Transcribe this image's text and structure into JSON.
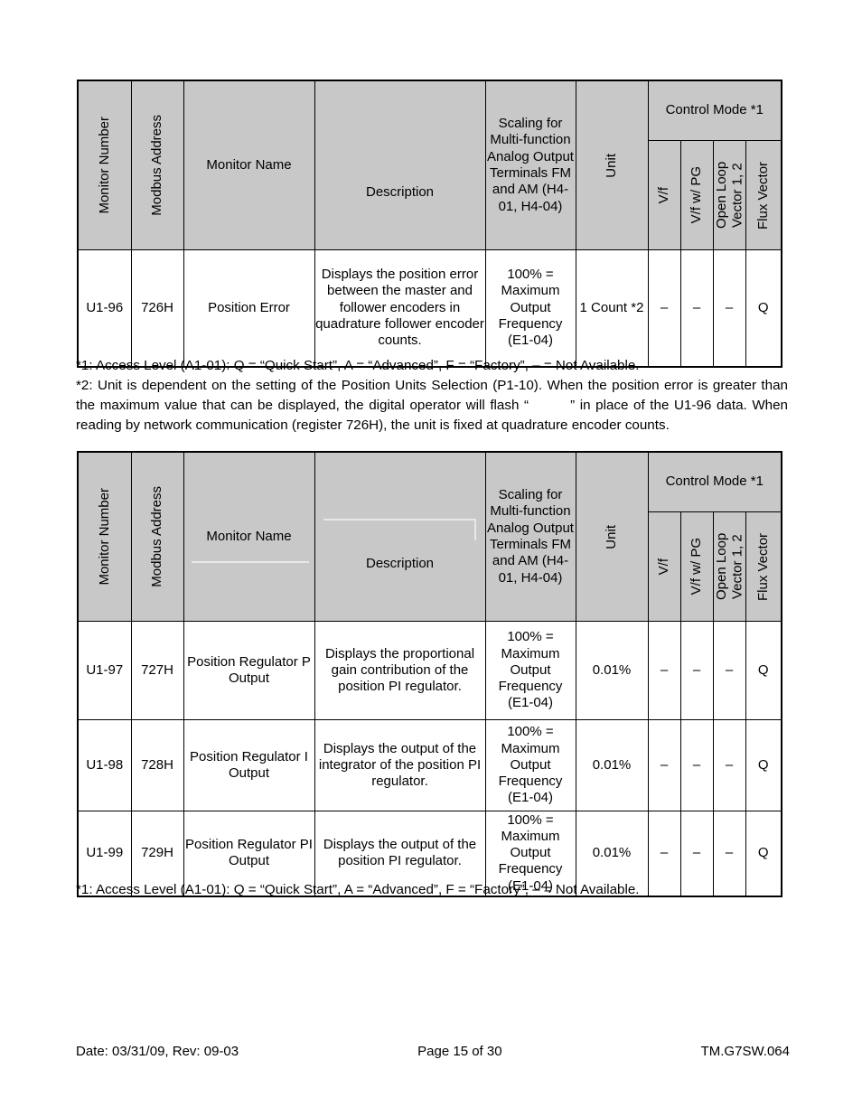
{
  "document": {
    "footer": {
      "date_rev": "Date: 03/31/09, Rev: 09-03",
      "page": "Page 15 of 30",
      "doc_number": "TM.G7SW.064"
    }
  },
  "table_headers": {
    "monitor_number": "Monitor Number",
    "modbus_address": "Modbus Address",
    "monitor_name": "Monitor Name",
    "description": "Description",
    "scaling": "Scaling for Multi-function Analog Output Terminals FM and AM (H4-01, H4-04)",
    "unit": "Unit",
    "control_mode": "Control Mode *1",
    "modes": {
      "vf": "V/f",
      "vf_pg": "V/f w/ PG",
      "open_loop_vector": "Open Loop Vector 1, 2",
      "flux_vector": "Flux Vector"
    }
  },
  "table1": {
    "rows": [
      {
        "monitor_number": "U1-96",
        "modbus_address": "726H",
        "monitor_name": "Position Error",
        "description": "Displays the position error between the master and follower encoders in quadrature follower encoder counts.",
        "scaling": "100% = Maximum Output Frequency (E1-04)",
        "unit": "1 Count *2",
        "vf": "–",
        "vf_pg": "–",
        "open_loop_vector": "–",
        "flux_vector": "Q"
      }
    ]
  },
  "table1_notes": {
    "note1": "*1: Access Level (A1-01): Q = “Quick Start”, A = “Advanced”, F = “Factory”, – = Not Available.",
    "note2_part1": "*2: Unit is dependent on the setting of the Position Units Selection (P1-10).  When the position error is greater than the maximum value that can be displayed, the digital operator will flash “",
    "note2_part2": "” in place of the U1-96 data. When reading by network communication (register 726H), the unit is fixed at quadrature encoder counts."
  },
  "table2": {
    "rows": [
      {
        "monitor_number": "U1-97",
        "modbus_address": "727H",
        "monitor_name": "Position Regulator P Output",
        "description": "Displays the proportional gain contribution of the position PI regulator.",
        "scaling": "100% = Maximum Output Frequency (E1-04)",
        "unit": "0.01%",
        "vf": "–",
        "vf_pg": "–",
        "open_loop_vector": "–",
        "flux_vector": "Q"
      },
      {
        "monitor_number": "U1-98",
        "modbus_address": "728H",
        "monitor_name": "Position Regulator I Output",
        "description": "Displays the output of the integrator of the position PI regulator.",
        "scaling": "100% = Maximum Output Frequency (E1-04)",
        "unit": "0.01%",
        "vf": "–",
        "vf_pg": "–",
        "open_loop_vector": "–",
        "flux_vector": "Q"
      },
      {
        "monitor_number": "U1-99",
        "modbus_address": "729H",
        "monitor_name": "Position Regulator PI Output",
        "description": "Displays the output of the position PI regulator.",
        "scaling": "100% = Maximum Output Frequency (E1-04)",
        "unit": "0.01%",
        "vf": "–",
        "vf_pg": "–",
        "open_loop_vector": "–",
        "flux_vector": "Q"
      }
    ]
  },
  "table2_notes": {
    "note1": "*1: Access Level (A1-01): Q = “Quick Start”, A = “Advanced”, F = “Factory”, – = Not Available."
  }
}
